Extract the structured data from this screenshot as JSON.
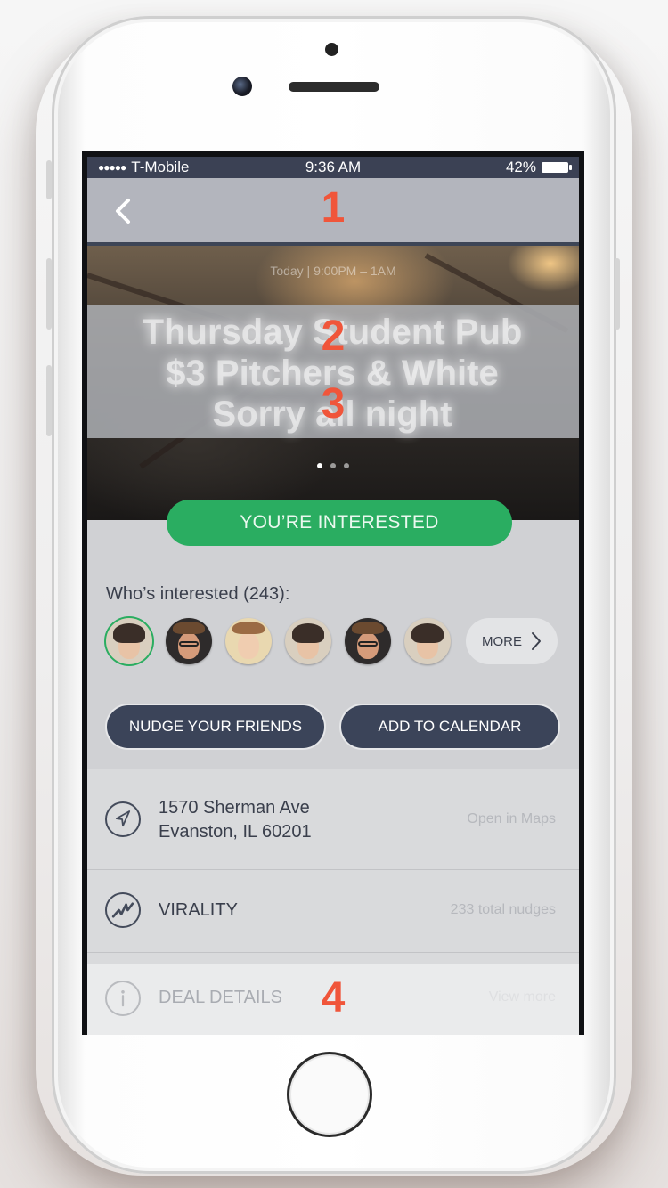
{
  "status_bar": {
    "carrier": "T-Mobile",
    "time": "9:36 AM",
    "battery": "42%",
    "signal_dots": "●●●●●"
  },
  "annotations": {
    "nav": "1",
    "title_line1": "2",
    "title_line2": "3",
    "deal": "4"
  },
  "hero": {
    "date_text": "Today | 9:00PM – 1AM",
    "blurred_title": "Thursday Student Pub $3 Pitchers & White Sorry all night",
    "page_count": 3,
    "active_page": 0
  },
  "interested_button": {
    "label": "YOU’RE INTERESTED",
    "color": "#2aad61"
  },
  "who_interested": {
    "label": "Who’s interested (243):",
    "more_label": "MORE",
    "avatars": [
      {
        "name": "avatar-1"
      },
      {
        "name": "avatar-2"
      },
      {
        "name": "avatar-3"
      },
      {
        "name": "avatar-4"
      },
      {
        "name": "avatar-5"
      },
      {
        "name": "avatar-6"
      }
    ]
  },
  "actions": {
    "nudge_label": "NUDGE YOUR FRIENDS",
    "calendar_label": "ADD TO CALENDAR"
  },
  "list": {
    "address_line1": "1570 Sherman Ave",
    "address_line2": "Evanston, IL 60201",
    "address_action": "Open in Maps",
    "virality_label": "VIRALITY",
    "virality_value": "233 total nudges",
    "deal_label": "DEAL DETAILS",
    "deal_action": "View more"
  },
  "colors": {
    "status_bar": "#3b4154",
    "nav_bar": "#b3b5bd",
    "button_dark": "#3b4459",
    "annotation": "#f0553a"
  },
  "icons": {
    "back": "chevron-left-icon",
    "location": "navigation-arrow-icon",
    "virality": "zigzag-icon",
    "deal": "info-icon",
    "more": "chevron-right-icon"
  }
}
